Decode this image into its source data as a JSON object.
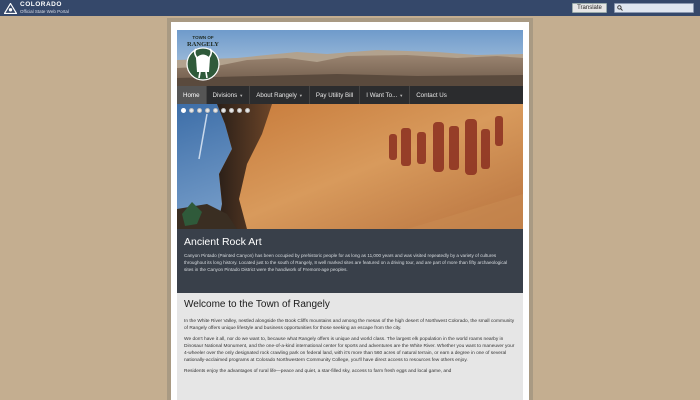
{
  "topbar": {
    "state_name": "COLORADO",
    "state_subtitle": "Official State Web Portal",
    "translate_label": "Translate",
    "search_placeholder": ""
  },
  "header": {
    "logo_top": "TOWN OF",
    "logo_name": "RANGELY"
  },
  "nav": {
    "items": [
      {
        "label": "Home",
        "dropdown": false,
        "active": true
      },
      {
        "label": "Divisions",
        "dropdown": true,
        "active": false
      },
      {
        "label": "About Rangely",
        "dropdown": true,
        "active": false
      },
      {
        "label": "Pay Utility Bill",
        "dropdown": false,
        "active": false
      },
      {
        "label": "I Want To...",
        "dropdown": true,
        "active": false
      },
      {
        "label": "Contact Us",
        "dropdown": false,
        "active": false
      }
    ]
  },
  "slideshow": {
    "slide_count": 9,
    "active_index": 0
  },
  "caption": {
    "title": "Ancient Rock Art",
    "text": "Canyon Pintado (Painted Canyon) has been occupied by prehistoric people for as long as 11,000 years and was visited repeatedly by a variety of cultures throughout its long history. Located just to the south of Rangely, 8 well marked sites are featured on a driving tour, and are part of more than fifty archaeological sites in the Canyon Pintado District were the handiwork of Fremont-age peoples."
  },
  "welcome": {
    "title": "Welcome to the Town of Rangely",
    "paragraphs": [
      "In the White River Valley, nestled alongside the Book Cliffs mountains and among the mesas of the high desert of Northwest Colorado, the small community of Rangely offers unique lifestyle and business opportunities for those seeking an escape from the city.",
      "We don't have it all, nor do we want to, because what Rangely offers is unique and world class. The largest elk population in the world roams nearby in Dinosaur National Monument, and the one-of-a-kind international center for sports and adventures are the White River. Whether you want to maneuver your 4-wheeler over the only designated rock crawling park on federal land, with it's more than 560 acres of natural terrain, or earn a degree in one of several nationally-acclaimed programs at Colorado Northwestern Community College, you'll have direct access to resources few others enjoy.",
      "Residents enjoy the advantages of rural life—peace and quiet, a star-filled sky, access to farm fresh eggs and local game, and"
    ]
  },
  "colors": {
    "topbar": "#35486a",
    "background": "#c4ae90",
    "nav": "#2b2c2e",
    "caption": "#39404a",
    "welcome": "#e6e6e6"
  }
}
